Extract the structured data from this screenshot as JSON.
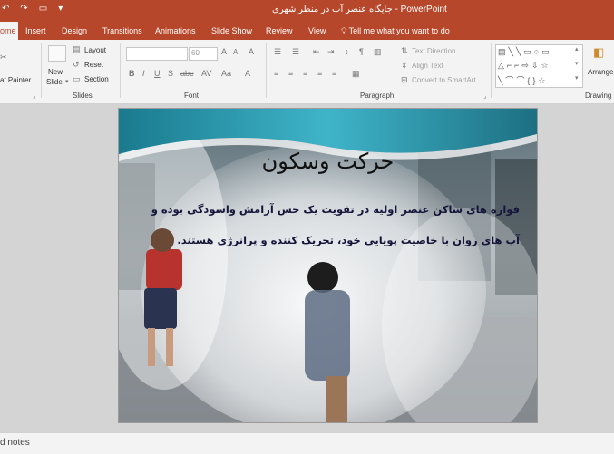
{
  "window": {
    "title": "جایگاه عنصر آب در منظر شهری  -  PowerPoint"
  },
  "tabs": [
    {
      "label": "ome"
    },
    {
      "label": "Insert"
    },
    {
      "label": "Design"
    },
    {
      "label": "Transitions"
    },
    {
      "label": "Animations"
    },
    {
      "label": "Slide Show"
    },
    {
      "label": "Review"
    },
    {
      "label": "View"
    }
  ],
  "tell_me": {
    "label": "Tell me what you want to do"
  },
  "ribbon": {
    "clipboard": {
      "format_painter": "at Painter"
    },
    "slides": {
      "new_slide_1": "New",
      "new_slide_2": "Slide",
      "layout": "Layout",
      "reset": "Reset",
      "section": "Section",
      "label": "Slides"
    },
    "font": {
      "size": "60",
      "label": "Font"
    },
    "paragraph": {
      "text_direction": "Text Direction",
      "align_text": "Align Text",
      "smartart": "Convert to SmartArt",
      "label": "Paragraph"
    },
    "drawing": {
      "arrange": "Arrange",
      "label": "Drawing"
    }
  },
  "slide": {
    "title": "حرکت وسکون",
    "body": "فواره های ساکن عنصر اولیه در تقویت یک حس آرامش واسودگی بوده و آب های روان با خاصیت پویایی خود، تحریک کننده و پرانرژی هستند."
  },
  "status": {
    "notes": "d notes"
  }
}
